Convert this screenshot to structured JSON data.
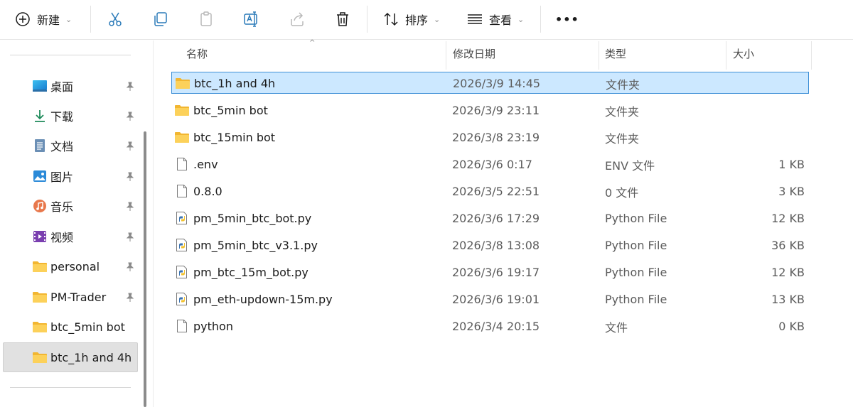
{
  "toolbar": {
    "new_label": "新建",
    "sort_label": "排序",
    "view_label": "查看",
    "more_label": "•••",
    "chevron": "⌄",
    "icons": [
      "plus-circle-icon",
      "scissors-icon",
      "copy-icon",
      "paste-icon",
      "rename-icon",
      "share-icon",
      "delete-icon",
      "sort-icon",
      "view-icon",
      "more-icon"
    ]
  },
  "sidebar": {
    "items": [
      {
        "label": "桌面",
        "icon": "desktop-icon",
        "pinned": true
      },
      {
        "label": "下载",
        "icon": "download-icon",
        "pinned": true
      },
      {
        "label": "文档",
        "icon": "documents-icon",
        "pinned": true
      },
      {
        "label": "图片",
        "icon": "pictures-icon",
        "pinned": true
      },
      {
        "label": "音乐",
        "icon": "music-icon",
        "pinned": true
      },
      {
        "label": "视频",
        "icon": "videos-icon",
        "pinned": true
      },
      {
        "label": "personal",
        "icon": "folder-icon",
        "pinned": true
      },
      {
        "label": "PM-Trader",
        "icon": "folder-icon",
        "pinned": true
      },
      {
        "label": "btc_5min bot",
        "icon": "folder-icon",
        "pinned": false
      },
      {
        "label": "btc_1h and 4h",
        "icon": "folder-icon",
        "pinned": false,
        "selected": true
      }
    ]
  },
  "list": {
    "headers": {
      "name": "名称",
      "date": "修改日期",
      "type": "类型",
      "size": "大小"
    },
    "sort_caret": "^",
    "rows": [
      {
        "name": "btc_1h and 4h",
        "date": "2026/3/9 14:45",
        "type": "文件夹",
        "size": "",
        "icon": "folder-icon",
        "selected": true
      },
      {
        "name": "btc_5min bot",
        "date": "2026/3/9 23:11",
        "type": "文件夹",
        "size": "",
        "icon": "folder-icon"
      },
      {
        "name": "btc_15min bot",
        "date": "2026/3/8 23:19",
        "type": "文件夹",
        "size": "",
        "icon": "folder-icon"
      },
      {
        "name": ".env",
        "date": "2026/3/6 0:17",
        "type": "ENV 文件",
        "size": "1 KB",
        "icon": "file-icon"
      },
      {
        "name": "0.8.0",
        "date": "2026/3/5 22:51",
        "type": "0 文件",
        "size": "3 KB",
        "icon": "file-icon"
      },
      {
        "name": "pm_5min_btc_bot.py",
        "date": "2026/3/6 17:29",
        "type": "Python File",
        "size": "12 KB",
        "icon": "python-file-icon"
      },
      {
        "name": "pm_5min_btc_v3.1.py",
        "date": "2026/3/8 13:08",
        "type": "Python File",
        "size": "36 KB",
        "icon": "python-file-icon"
      },
      {
        "name": "pm_btc_15m_bot.py",
        "date": "2026/3/6 19:17",
        "type": "Python File",
        "size": "12 KB",
        "icon": "python-file-icon"
      },
      {
        "name": "pm_eth-updown-15m.py",
        "date": "2026/3/6 19:01",
        "type": "Python File",
        "size": "13 KB",
        "icon": "python-file-icon"
      },
      {
        "name": "python",
        "date": "2026/3/4 20:15",
        "type": "文件",
        "size": "0 KB",
        "icon": "file-icon"
      }
    ]
  },
  "colors": {
    "selection_bg": "#cce8ff",
    "selection_border": "#3d8fd6",
    "folder": "#f8c84a",
    "sidebar_selected": "#e1e1e1"
  }
}
